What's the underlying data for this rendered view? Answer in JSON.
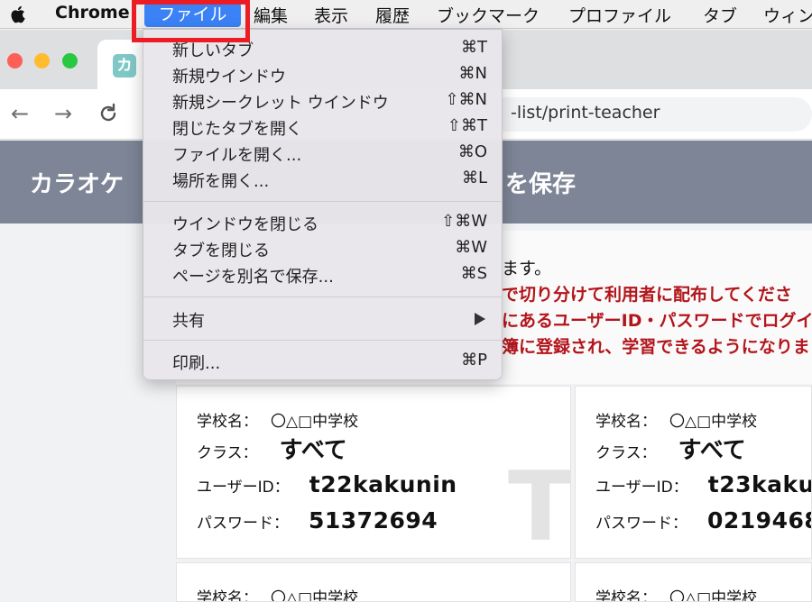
{
  "menubar": {
    "app_name": "Chrome",
    "file": "ファイル",
    "items": [
      "編集",
      "表示",
      "履歴",
      "ブックマーク",
      "プロファイル",
      "タブ",
      "ウィン"
    ]
  },
  "tab": {
    "favicon_char": "カ"
  },
  "toolbar": {
    "url_visible": "-list/print-teacher"
  },
  "header": {
    "title_visible": "カラオケ",
    "save_visible": "を保存"
  },
  "file_menu": {
    "groups": [
      [
        {
          "label": "新しいタブ",
          "shortcut": "⌘T"
        },
        {
          "label": "新規ウインドウ",
          "shortcut": "⌘N"
        },
        {
          "label": "新規シークレット ウインドウ",
          "shortcut": "⇧⌘N"
        },
        {
          "label": "閉じたタブを開く",
          "shortcut": "⇧⌘T"
        },
        {
          "label": "ファイルを開く...",
          "shortcut": "⌘O"
        },
        {
          "label": "場所を開く...",
          "shortcut": "⌘L"
        }
      ],
      [
        {
          "label": "ウインドウを閉じる",
          "shortcut": "⇧⌘W"
        },
        {
          "label": "タブを閉じる",
          "shortcut": "⌘W"
        },
        {
          "label": "ページを別名で保存...",
          "shortcut": "⌘S"
        }
      ],
      [
        {
          "label": "共有",
          "shortcut": ""
        }
      ],
      [
        {
          "label": "印刷...",
          "shortcut": "⌘P"
        }
      ]
    ]
  },
  "notice": {
    "line1": "ます。",
    "line2": "で切り分けて利用者に配布してくださ",
    "line3": "にあるユーザーID・パスワードでログイ",
    "line4": "簿に登録され、学習できるようになりま"
  },
  "cards": [
    {
      "school_label": "学校名：",
      "school": "〇△□中学校",
      "class_label": "クラス：",
      "class": "すべて",
      "user_label": "ユーザーID：",
      "user": "t22kakunin",
      "pass_label": "パスワード：",
      "pass": "51372694",
      "watermark": "T"
    },
    {
      "school_label": "学校名：",
      "school": "〇△□中学校",
      "class_label": "クラス：",
      "class": "すべて",
      "user_label": "ユーザーID：",
      "user": "t23kaku",
      "pass_label": "パスワード：",
      "pass": "0219468"
    },
    {
      "school_label": "学校名：",
      "school": "〇△□中学校"
    },
    {
      "school_label": "学校名：",
      "school": "〇△□中学校"
    }
  ]
}
